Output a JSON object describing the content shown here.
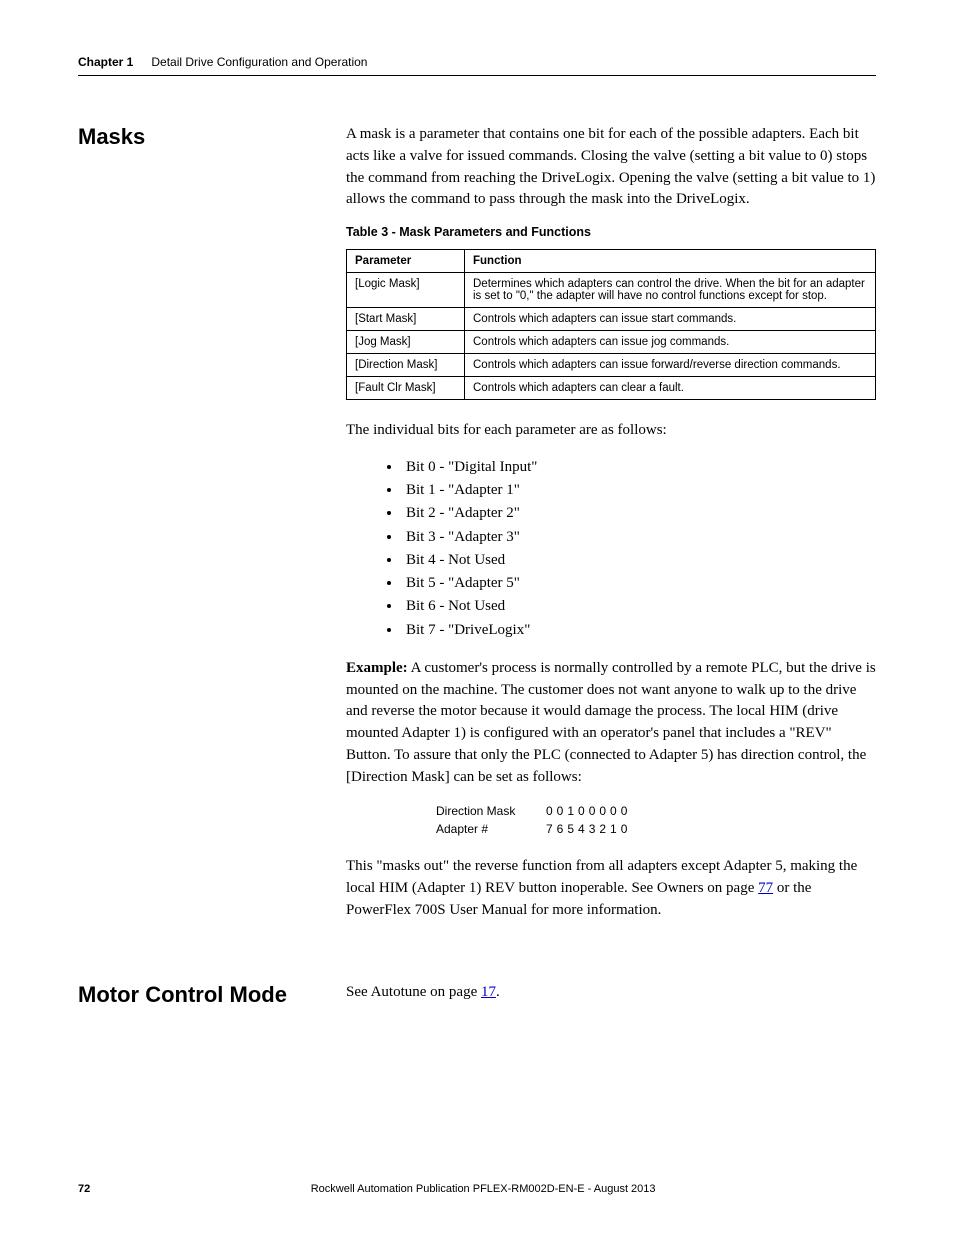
{
  "header": {
    "chapter_label": "Chapter 1",
    "chapter_title": "Detail Drive Configuration and Operation"
  },
  "section_masks": {
    "title": "Masks",
    "intro": "A mask is a parameter that contains one bit for each of the possible adapters. Each bit acts like a valve for issued commands. Closing the valve (setting a bit value to 0) stops the command from reaching the DriveLogix. Opening the valve (setting a bit value to 1) allows the command to pass through the mask into the DriveLogix.",
    "table_caption": "Table 3 - Mask Parameters and Functions",
    "table_headers": {
      "param": "Parameter",
      "func": "Function"
    },
    "table_rows": [
      {
        "param": "[Logic Mask]",
        "func": "Determines which adapters can control the drive. When the bit for an adapter is set to \"0,\" the adapter will have no control functions except for stop."
      },
      {
        "param": "[Start Mask]",
        "func": "Controls which adapters can issue start commands."
      },
      {
        "param": "[Jog Mask]",
        "func": "Controls which adapters can issue jog commands."
      },
      {
        "param": "[Direction Mask]",
        "func": "Controls which adapters can issue forward/reverse direction commands."
      },
      {
        "param": "[Fault Clr Mask]",
        "func": "Controls which adapters can clear a fault."
      }
    ],
    "bits_intro": "The individual bits for each parameter are as follows:",
    "bits": [
      "Bit 0 - \"Digital Input\"",
      "Bit 1 - \"Adapter 1\"",
      "Bit 2 - \"Adapter 2\"",
      "Bit 3 - \"Adapter 3\"",
      "Bit 4 - Not Used",
      "Bit 5 - \"Adapter 5\"",
      "Bit 6 - Not Used",
      "Bit 7 - \"DriveLogix\""
    ],
    "example_label": "Example:",
    "example_text": " A customer's process is normally controlled by a remote PLC, but the drive is mounted on the machine. The customer does not want anyone to walk up to the drive and reverse the motor because it would damage the process. The local HIM (drive mounted Adapter 1) is configured with an operator's panel that includes a \"REV\" Button. To assure that only the PLC (connected to Adapter 5) has direction control, the [Direction Mask] can be set as follows:",
    "mask_rows": [
      {
        "label": "Direction Mask",
        "vals": "00100000"
      },
      {
        "label": "Adapter #",
        "vals": "76543210"
      }
    ],
    "closing_pre": "This \"masks out\" the reverse function from all adapters except Adapter 5, making the local HIM (Adapter 1) REV button inoperable. See Owners on page ",
    "closing_link": "77",
    "closing_post": " or the PowerFlex 700S User Manual for more information."
  },
  "section_motor": {
    "title": "Motor Control Mode",
    "text_pre": "See Autotune on page ",
    "link": "17",
    "text_post": "."
  },
  "footer": {
    "page": "72",
    "text": "Rockwell Automation Publication PFLEX-RM002D-EN-E - August 2013"
  }
}
